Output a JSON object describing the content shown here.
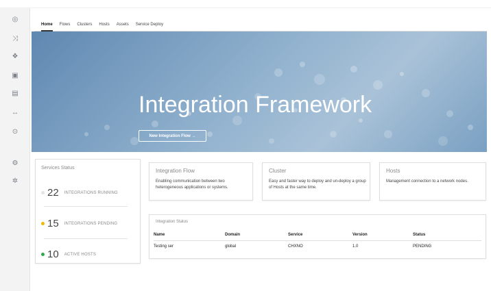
{
  "header": {
    "brand": "",
    "user": ""
  },
  "sidebar": {
    "items": [
      {
        "icon": "home-icon",
        "glyph": "◎"
      },
      {
        "icon": "flows-icon",
        "glyph": "⤨"
      },
      {
        "icon": "clusters-icon",
        "glyph": "❖"
      },
      {
        "icon": "hosts-icon",
        "glyph": "▣"
      },
      {
        "icon": "assets-icon",
        "glyph": "▤"
      },
      {
        "icon": "code-icon",
        "glyph": "↔"
      },
      {
        "icon": "monitor-icon",
        "glyph": "⊙"
      },
      {
        "icon": "settings-icon",
        "glyph": "⚙"
      },
      {
        "icon": "gear-icon",
        "glyph": "✲"
      }
    ]
  },
  "tabs": [
    "Home",
    "Flows",
    "Clusters",
    "Hosts",
    "Assets",
    "Service Deploy"
  ],
  "hero": {
    "title": "Integration Framework",
    "button": "New Integration Flow →"
  },
  "services_status": {
    "title": "Services Status",
    "stats": [
      {
        "count": "22",
        "label": "INTEGRATIONS RUNNING",
        "color": "#e4e4e4"
      },
      {
        "count": "15",
        "label": "INTEGRATIONS PENDING",
        "color": "#f2b705"
      },
      {
        "count": "10",
        "label": "ACTIVE HOSTS",
        "color": "#2fa84f"
      }
    ]
  },
  "cards": [
    {
      "title": "Integration Flow",
      "text": "Enabling communication between two heterogeneous applications or systems."
    },
    {
      "title": "Cluster",
      "text": "Easy and faster way to deploy and un-deploy a group of Hosts at the same time."
    },
    {
      "title": "Hosts",
      "text": "Management connection to a network nodes."
    }
  ],
  "integration_status": {
    "title": "Integration Status",
    "columns": [
      "Name",
      "Domain",
      "Service",
      "Version",
      "Status"
    ],
    "rows": [
      [
        "Testing ser",
        "global",
        "CHXNO",
        "1.0",
        "PENDING"
      ]
    ]
  }
}
